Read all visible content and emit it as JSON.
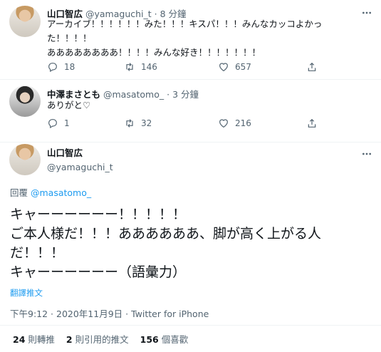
{
  "tweets": [
    {
      "name": "山口智広",
      "handle": "@yamaguchi_t",
      "dot": "·",
      "time": "8 分鐘",
      "lines": [
        "アーカイブ！！！！！！みた！！！キスパ！！！みんなカッコよかっ",
        "た！！！！",
        "ああああああああ！！！！みんな好き！！！！！！！"
      ],
      "replies": "18",
      "retweets": "146",
      "likes": "657"
    },
    {
      "name": "中澤まさとも",
      "handle": "@masatomo_",
      "dot": "·",
      "time": "3 分鐘",
      "lines": [
        "ありがと♡"
      ],
      "replies": "1",
      "retweets": "32",
      "likes": "216"
    }
  ],
  "main": {
    "name": "山口智広",
    "handle": "@yamaguchi_t",
    "reply_prefix": "回覆",
    "reply_to": "@masatomo_",
    "lines": [
      "キャーーーーーー！！！！！",
      "ご本人様だ！！！ああああああ、脚が高く上がる人",
      "だ！！！",
      "キャーーーーーー（語彙力）"
    ],
    "translate": "翻譯推文",
    "meta": "下午9:12 · 2020年11月9日 · Twitter for iPhone",
    "stats": [
      {
        "num": "24",
        "label": "則轉推"
      },
      {
        "num": "2",
        "label": "則引用的推文"
      },
      {
        "num": "156",
        "label": "個喜歡"
      }
    ]
  },
  "icons": {
    "more": "more-icon",
    "reply": "reply-icon",
    "retweet": "retweet-icon",
    "like": "heart-icon",
    "share": "share-icon"
  },
  "colors": {
    "accent": "#1d9bf0",
    "secondary_text": "#536471"
  }
}
